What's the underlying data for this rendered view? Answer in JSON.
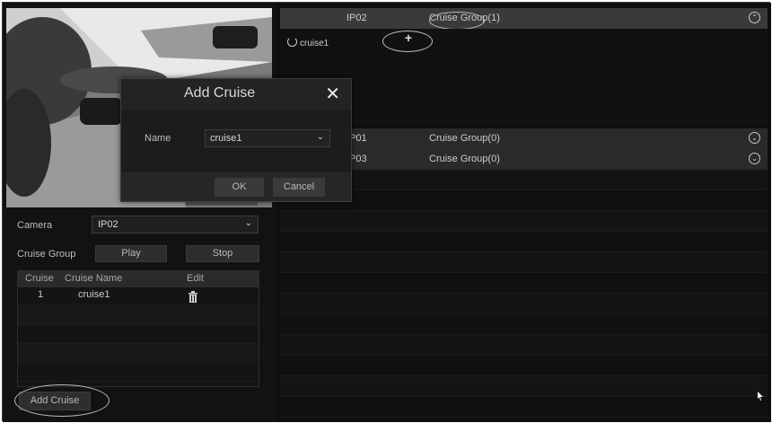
{
  "left_panel": {
    "camera_label": "Camera",
    "camera_value": "IP02",
    "cruise_group_label": "Cruise Group",
    "play_label": "Play",
    "stop_label": "Stop",
    "table": {
      "headers": [
        "Cruise",
        "Cruise Name",
        "Edit"
      ],
      "rows": [
        {
          "cruise": "1",
          "name": "cruise1"
        }
      ]
    },
    "add_cruise_label": "Add Cruise"
  },
  "right_panel": {
    "groups": [
      {
        "camera": "IP02",
        "name": "Cruise Group(1)",
        "expanded": true,
        "cruises": [
          "cruise1"
        ]
      },
      {
        "camera": "IP01",
        "name": "Cruise Group(0)",
        "expanded": false
      },
      {
        "camera": "IP03",
        "name": "Cruise Group(0)",
        "expanded": false
      }
    ]
  },
  "modal": {
    "title": "Add Cruise",
    "name_label": "Name",
    "name_value": "cruise1",
    "ok_label": "OK",
    "cancel_label": "Cancel"
  },
  "icons": {
    "close": "close-icon",
    "trash": "trash-icon",
    "toggle_up": "chevron-up-icon",
    "toggle_down": "chevron-down-icon",
    "add": "plus-icon"
  }
}
